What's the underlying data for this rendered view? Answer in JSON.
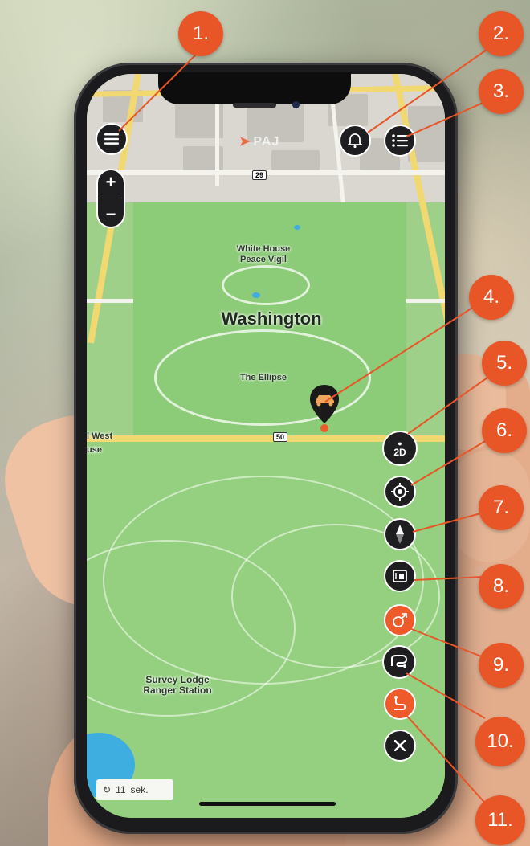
{
  "brand": {
    "name": "PAJ",
    "accent": "#ef5a2a"
  },
  "map": {
    "labels": {
      "city": "Washington",
      "poi_whitehouse": "White House\nPeace Vigil",
      "poi_ellipse": "The Ellipse",
      "poi_lodge": "Survey Lodge\nRanger Station",
      "street_west": "l West",
      "street_use": "use"
    },
    "shields": {
      "top": "29",
      "mid": "50"
    }
  },
  "controls": {
    "zoom_in": "+",
    "zoom_out": "−",
    "view_mode": "2D",
    "timer_value": "11",
    "timer_unit": "sek."
  },
  "callouts": [
    "1.",
    "2.",
    "3.",
    "4.",
    "5.",
    "6.",
    "7.",
    "8.",
    "9.",
    "10.",
    "11."
  ],
  "icons": {
    "menu": "hamburger-icon",
    "alerts": "bell-icon",
    "list": "list-icon",
    "vehicle_pin": "car-pin-icon",
    "view_toggle": "2d-view-icon",
    "locate": "locate-icon",
    "compass": "compass-icon",
    "map_layers": "map-layers-icon",
    "geofence": "geofence-icon",
    "route": "route-icon",
    "history": "history-icon",
    "close": "close-icon",
    "refresh": "refresh-icon"
  }
}
